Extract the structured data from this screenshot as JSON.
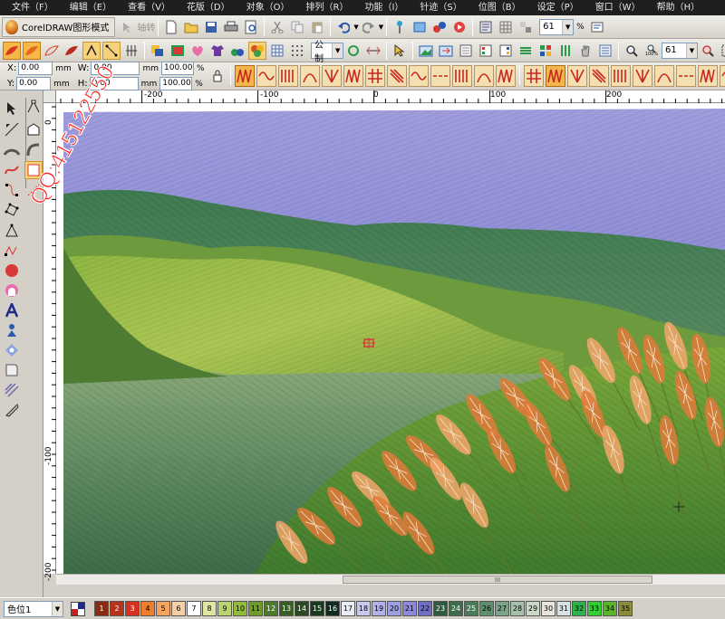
{
  "menu": [
    "文件（F）",
    "编辑（E）",
    "查看（V）",
    "花版（D）",
    "对象（O）",
    "排列（R）",
    "功能（I）",
    "针迹（S）",
    "位图（B）",
    "设定（P）",
    "窗口（W）",
    "帮助（H）"
  ],
  "app_mode_label": "CorelDRAW图形模式",
  "toolbar1": {
    "disabled_label": "轴转",
    "zoom_value": "61",
    "zoom_unit": "%"
  },
  "toolbar2": {
    "unit_select": "公制",
    "zoom_label": "100%",
    "zoom_value": "61"
  },
  "props": {
    "x_label": "X:",
    "x_value": "0.00",
    "x_unit": "mm",
    "y_label": "Y:",
    "y_value": "0.00",
    "y_unit": "mm",
    "w_label": "W:",
    "w_value": "0.00",
    "w_unit": "mm",
    "h_label": "H:",
    "h_value": "0.00",
    "h_unit": "mm",
    "w_pct": "100.00",
    "h_pct": "100.00",
    "pct": "%"
  },
  "ruler": {
    "h_labels": [
      "-200",
      "-100",
      "0",
      "100",
      "200"
    ],
    "v_labels": [
      "0",
      "-100",
      "-200"
    ]
  },
  "watermark": "QQ:415122550",
  "scroll_thumb_label": "III",
  "color_select": "色位1",
  "colors": {
    "accent_orange": "#f3b64c",
    "sky": "#8f8fd6",
    "reeds": "#e07a3a"
  },
  "palette": [
    {
      "n": "1",
      "c": "#8a2b13"
    },
    {
      "n": "2",
      "c": "#b8321a"
    },
    {
      "n": "3",
      "c": "#d8311f"
    },
    {
      "n": "4",
      "c": "#f07e2a"
    },
    {
      "n": "5",
      "c": "#f7a35b"
    },
    {
      "n": "6",
      "c": "#f6d0a4"
    },
    {
      "n": "7",
      "c": "#ffffff"
    },
    {
      "n": "8",
      "c": "#dfe6a2"
    },
    {
      "n": "9",
      "c": "#b9d372"
    },
    {
      "n": "10",
      "c": "#93bb3a"
    },
    {
      "n": "11",
      "c": "#6f9b2c"
    },
    {
      "n": "12",
      "c": "#4c7a2a"
    },
    {
      "n": "13",
      "c": "#385f23"
    },
    {
      "n": "14",
      "c": "#2b4a22"
    },
    {
      "n": "15",
      "c": "#1c3a22"
    },
    {
      "n": "16",
      "c": "#0f2a1e"
    },
    {
      "n": "17",
      "c": "#e9eef6"
    },
    {
      "n": "18",
      "c": "#c9c9ee"
    },
    {
      "n": "19",
      "c": "#b2b2e8"
    },
    {
      "n": "20",
      "c": "#9d9de2"
    },
    {
      "n": "21",
      "c": "#8c8ad8"
    },
    {
      "n": "22",
      "c": "#6f6dc6"
    },
    {
      "n": "23",
      "c": "#2e5a3f"
    },
    {
      "n": "24",
      "c": "#3e6b4c"
    },
    {
      "n": "25",
      "c": "#4a7a5a"
    },
    {
      "n": "26",
      "c": "#5e8e6b"
    },
    {
      "n": "27",
      "c": "#7aa48a"
    },
    {
      "n": "28",
      "c": "#a6c1ab"
    },
    {
      "n": "29",
      "c": "#cad8c8"
    },
    {
      "n": "30",
      "c": "#e6e6de"
    },
    {
      "n": "31",
      "c": "#d6e2e6"
    },
    {
      "n": "32",
      "c": "#2bb34a"
    },
    {
      "n": "33",
      "c": "#2fd12f"
    },
    {
      "n": "34",
      "c": "#58b52a"
    },
    {
      "n": "35",
      "c": "#8a8a3a"
    }
  ]
}
